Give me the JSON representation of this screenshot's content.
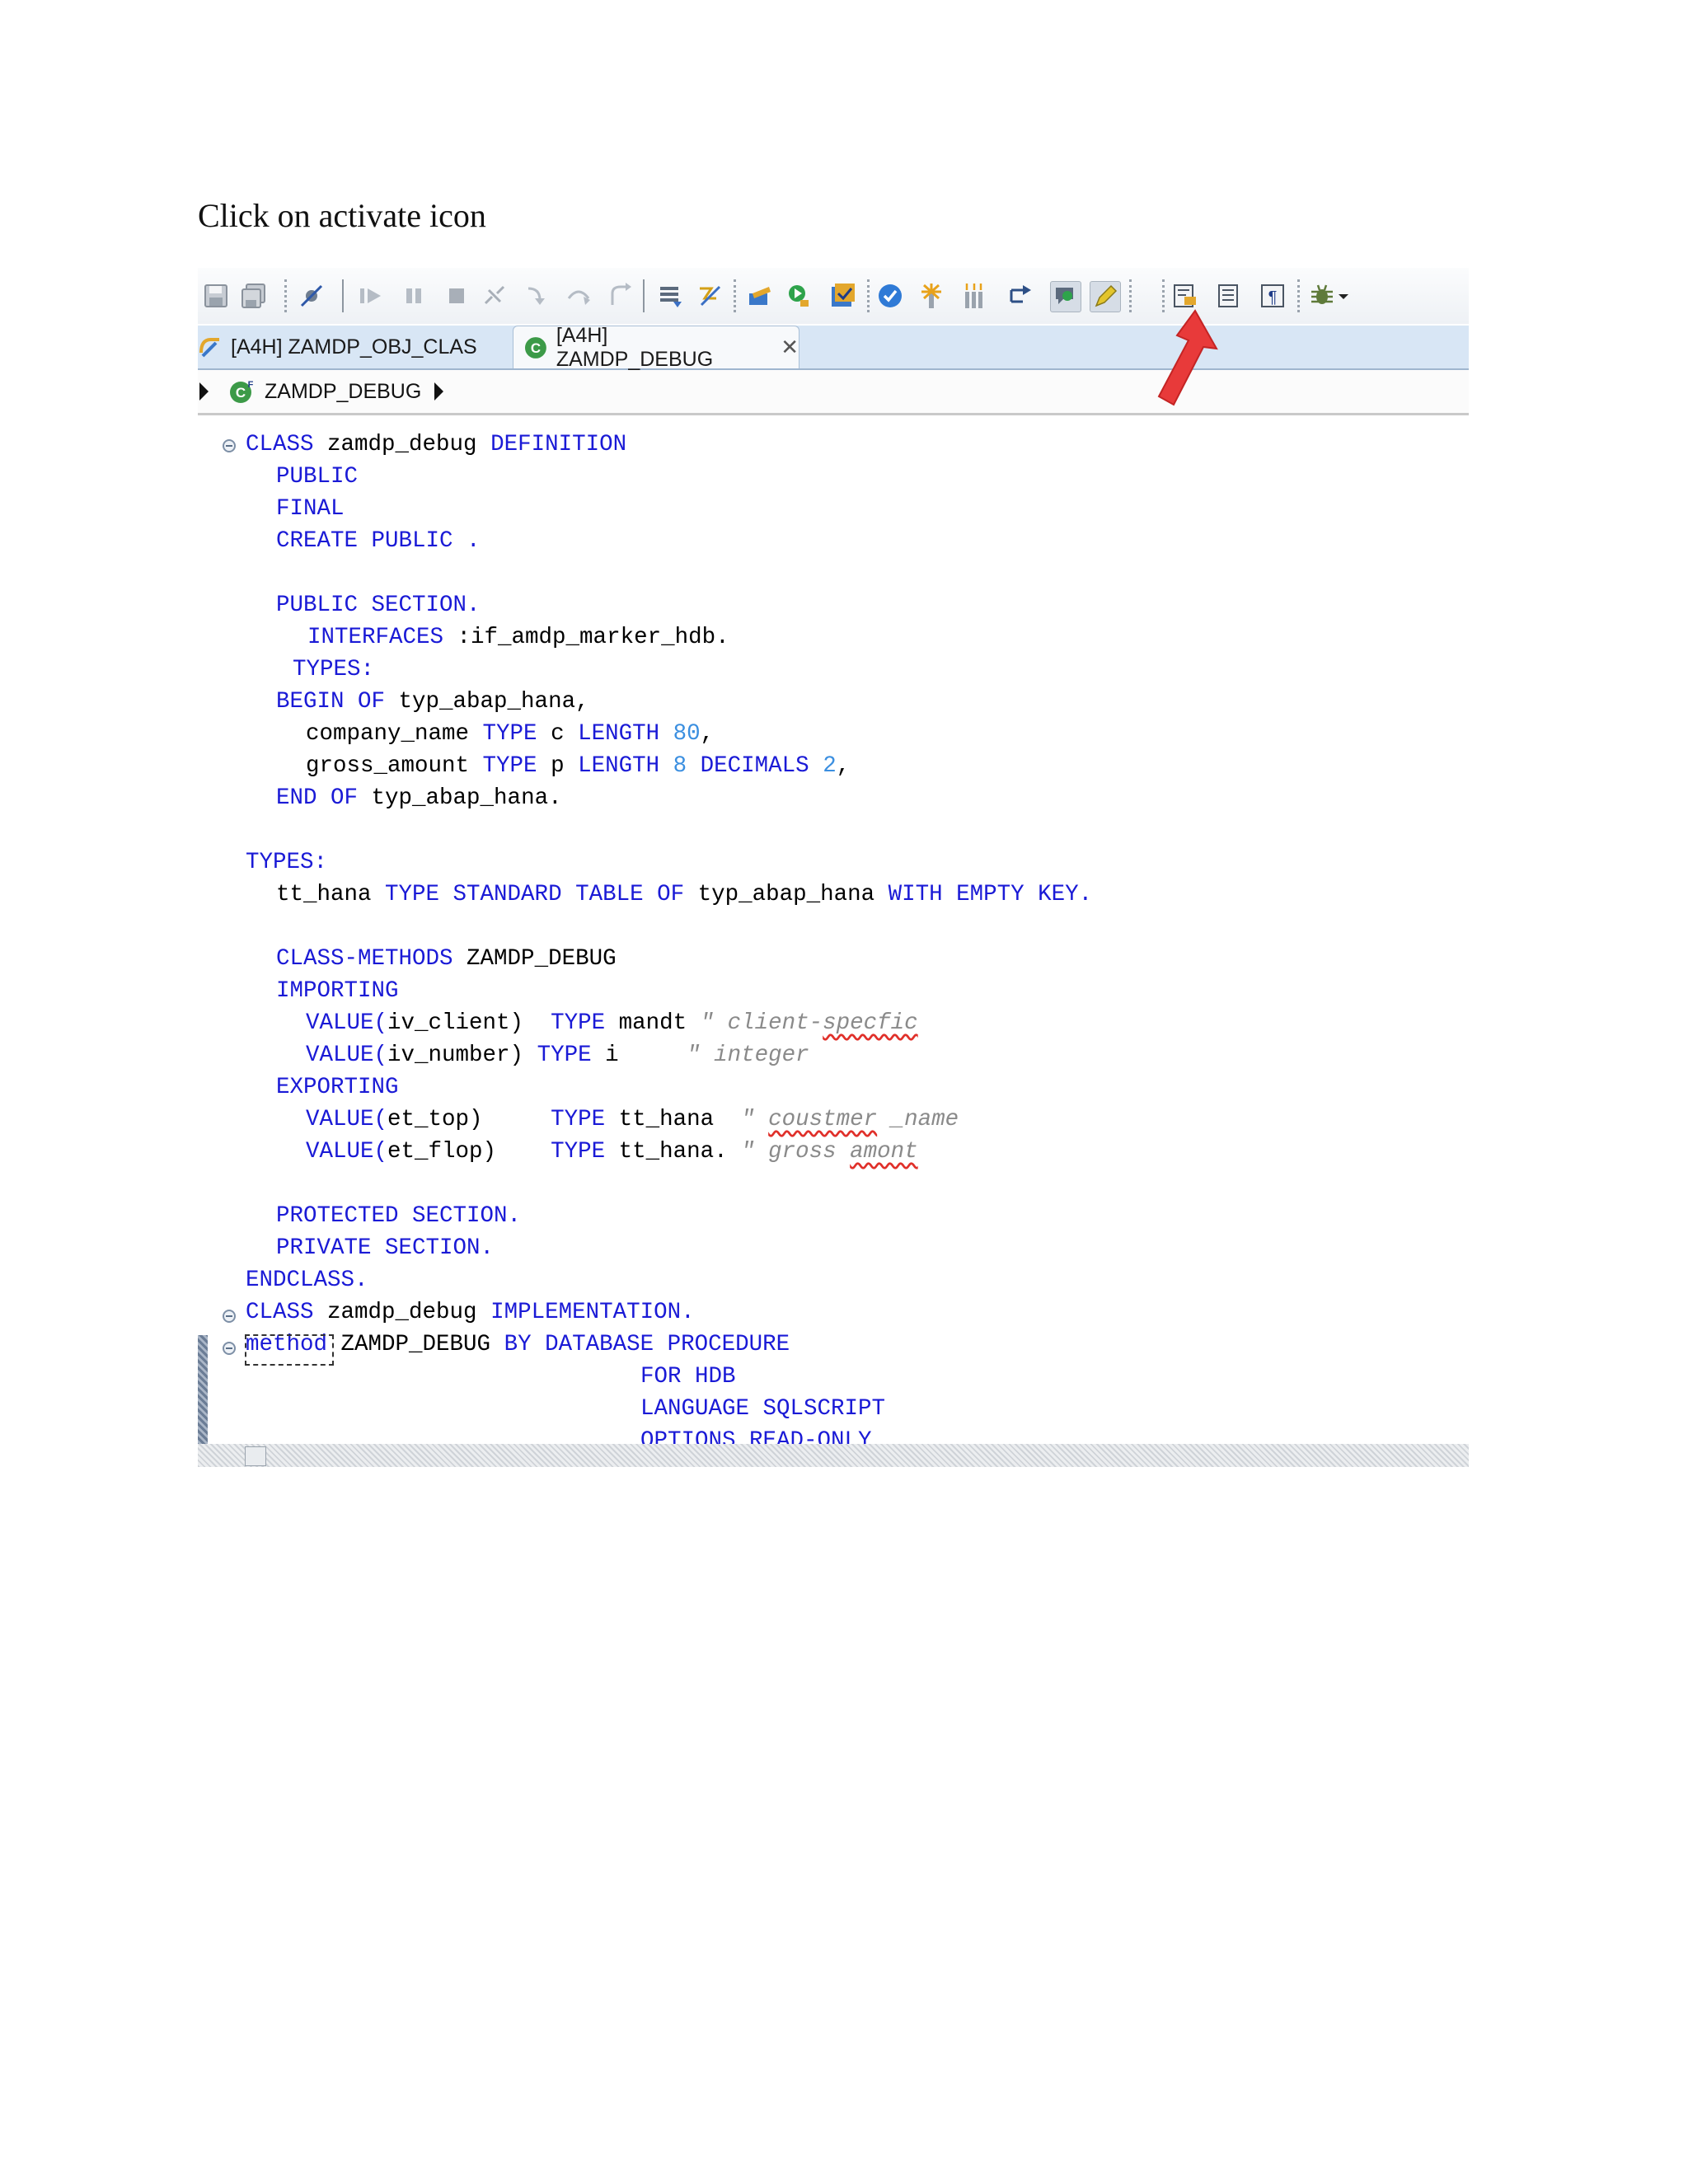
{
  "instruction": "Click on activate icon",
  "tabs": [
    {
      "label": "[A4H] ZAMDP_OBJ_CLAS",
      "active": false
    },
    {
      "label": "[A4H] ZAMDP_DEBUG",
      "active": true,
      "close": "✕"
    }
  ],
  "breadcrumb": {
    "label": "ZAMDP_DEBUG"
  },
  "toolbar": {
    "icons": [
      "save-icon",
      "save-all-icon",
      "skip-breakpoints-icon",
      "resume-icon",
      "suspend-icon",
      "terminate-icon",
      "disconnect-icon",
      "step-into-icon",
      "step-over-icon",
      "step-return-icon",
      "drop-to-frame-icon",
      "step-filters-icon",
      "open-object-icon",
      "run-icon",
      "check-icon",
      "activate-check-icon",
      "activate-icon",
      "activate-all-icon",
      "connect-icon",
      "toggle-highlight-icon",
      "mark-occurrences-icon",
      "pretty-printer-icon",
      "show-whitespace-icon",
      "format-icon",
      "debug-icon",
      "dropdown-icon"
    ]
  },
  "code": [
    "CLASS zamdp_debug DEFINITION",
    "PUBLIC",
    "FINAL",
    "CREATE PUBLIC .",
    "",
    "PUBLIC SECTION.",
    "INTERFACES :if_amdp_marker_hdb.",
    "TYPES:",
    "BEGIN OF typ_abap_hana,",
    "company_name TYPE c LENGTH 80,",
    "gross_amount TYPE p LENGTH 8 DECIMALS 2,",
    "END OF typ_abap_hana.",
    "",
    "TYPES:",
    "tt_hana TYPE STANDARD TABLE OF typ_abap_hana WITH EMPTY KEY.",
    "",
    "CLASS-METHODS ZAMDP_DEBUG",
    "IMPORTING",
    "VALUE(iv_client)  TYPE mandt \" client-specfic",
    "VALUE(iv_number) TYPE i     \" integer",
    "EXPORTING",
    "VALUE(et_top)     TYPE tt_hana  \" coustmer _name",
    "VALUE(et_flop)    TYPE tt_hana. \" gross amont",
    "",
    "PROTECTED SECTION.",
    "PRIVATE SECTION.",
    "ENDCLASS.",
    "CLASS zamdp_debug IMPLEMENTATION.",
    "method ZAMDP_DEBUG BY DATABASE PROCEDURE",
    "FOR HDB",
    "LANGUAGE SQLSCRIPT",
    "OPTIONS READ-ONLY"
  ],
  "colors": {
    "keyword": "#1a1ad6",
    "number": "#3b8fe0",
    "comment": "#8a8a8a",
    "tab_bar": "#d8e6f5",
    "arrow": "#e83a3a"
  }
}
